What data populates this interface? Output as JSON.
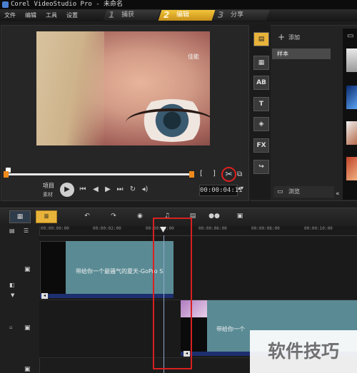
{
  "window": {
    "title": "Corel VideoStudio Pro - 未命名"
  },
  "menu": {
    "file": "文件",
    "edit": "编辑",
    "tools": "工具",
    "settings": "设置"
  },
  "steps": [
    {
      "num": "1",
      "label": "捕获"
    },
    {
      "num": "2",
      "label": "编辑",
      "active": true
    },
    {
      "num": "3",
      "label": "分享"
    }
  ],
  "preview": {
    "watermark": "佳能",
    "mode_project": "项目",
    "mode_clip": "素材",
    "mark_in": "[",
    "mark_out": "]",
    "timecode": "00:00:04:11"
  },
  "library": {
    "add_label": "添加",
    "folder": "样本",
    "browse_label": "浏览"
  },
  "timeline": {
    "ruler_ticks": [
      "00:00:00:00",
      "00:00:02:00",
      "00:00:04:00",
      "00:00:06:00",
      "00:00:08:00",
      "00:00:10:00"
    ],
    "clip_text": "带给你一个最骚气的夏天-GoPro S",
    "clip_text_2": "带给你一个"
  },
  "overlay_watermark": "软件技巧",
  "colors": {
    "accent": "#e8b33a",
    "highlight_box": "#d82020",
    "clip": "#5a8b95"
  }
}
